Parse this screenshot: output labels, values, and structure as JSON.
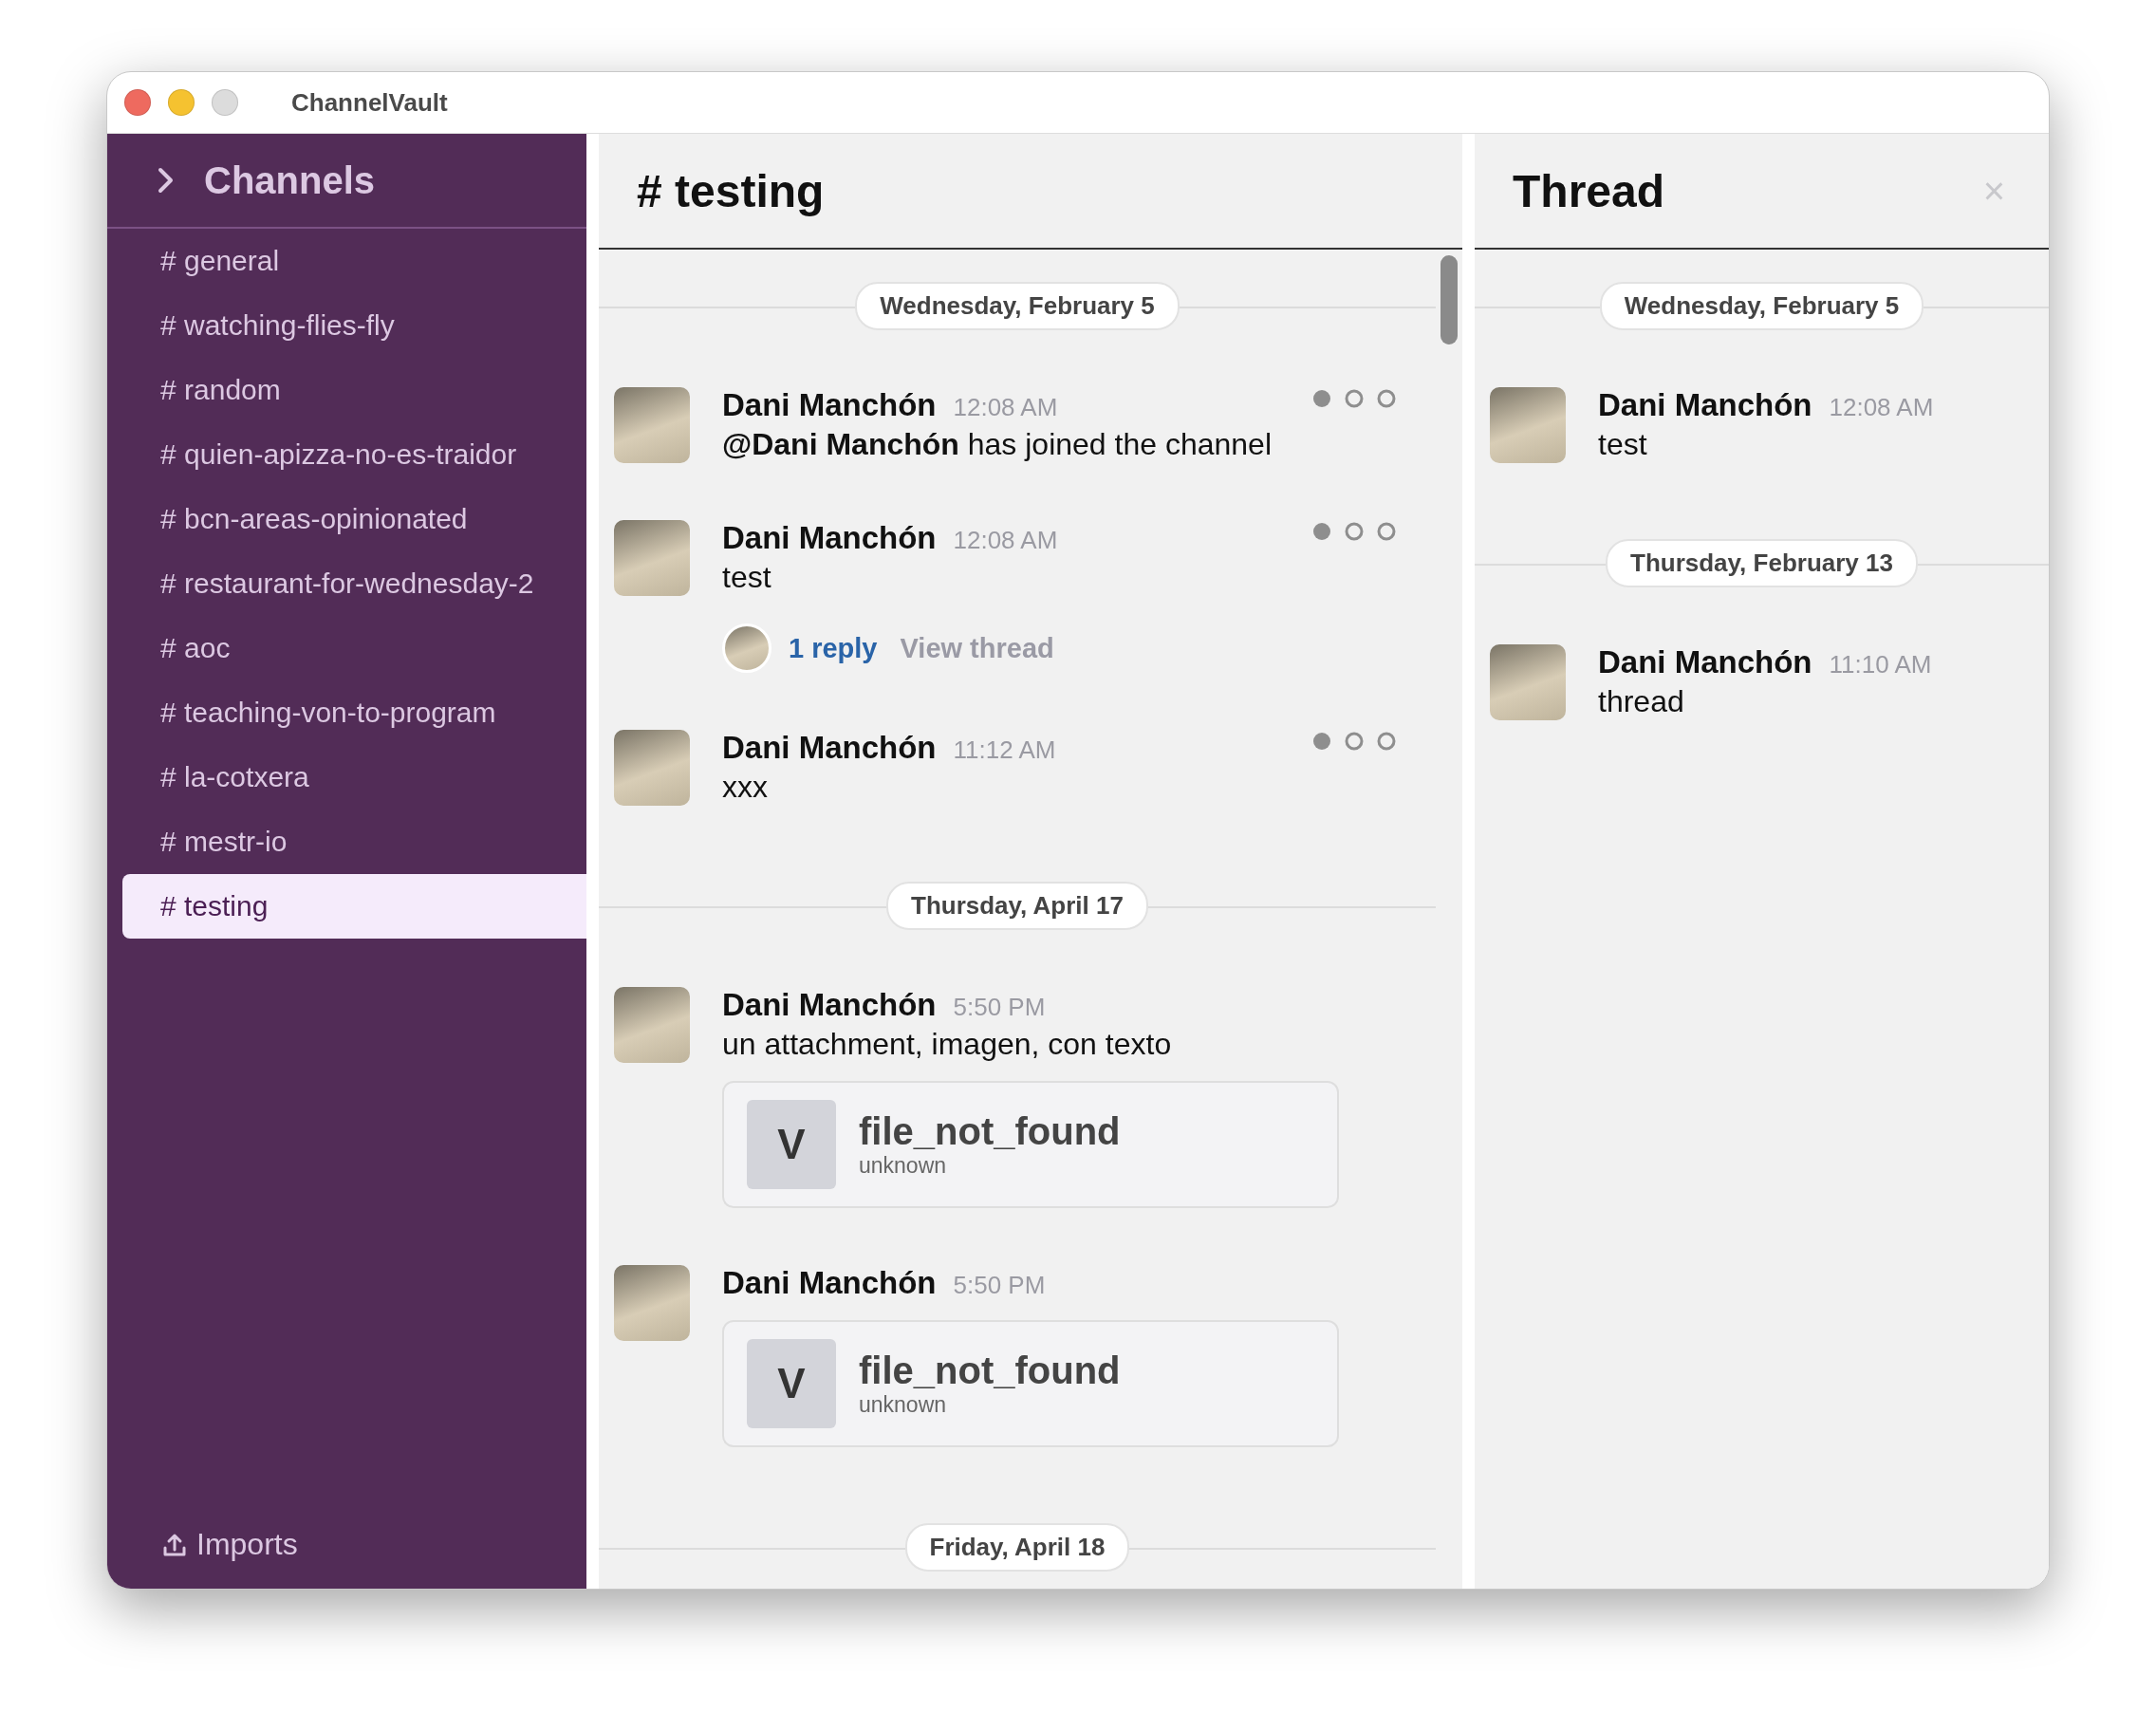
{
  "window": {
    "title": "ChannelVault"
  },
  "sidebar": {
    "header": "Channels",
    "channels": [
      {
        "name": "# general",
        "selected": false
      },
      {
        "name": "# watching-flies-fly",
        "selected": false
      },
      {
        "name": "# random",
        "selected": false
      },
      {
        "name": "# quien-apizza-no-es-traidor",
        "selected": false
      },
      {
        "name": "# bcn-areas-opinionated",
        "selected": false
      },
      {
        "name": "# restaurant-for-wednesday-2",
        "selected": false
      },
      {
        "name": "# aoc",
        "selected": false
      },
      {
        "name": "# teaching-von-to-program",
        "selected": false
      },
      {
        "name": "# la-cotxera",
        "selected": false
      },
      {
        "name": "# mestr-io",
        "selected": false
      },
      {
        "name": "# testing",
        "selected": true
      }
    ],
    "footer": "Imports"
  },
  "channel": {
    "title": "# testing",
    "timeline": [
      {
        "kind": "date",
        "label": "Wednesday, February 5"
      },
      {
        "kind": "message",
        "author": "Dani Manchón",
        "time": "12:08 AM",
        "text": "**@Dani Manchón** has joined the channel",
        "status_dots": true
      },
      {
        "kind": "message",
        "author": "Dani Manchón",
        "time": "12:08 AM",
        "text": "test",
        "replies": {
          "count": "1 reply",
          "link": "View thread"
        },
        "status_dots": true
      },
      {
        "kind": "message",
        "author": "Dani Manchón",
        "time": "11:12 AM",
        "text": "xxx",
        "status_dots": true
      },
      {
        "kind": "date",
        "label": "Thursday, April 17"
      },
      {
        "kind": "message",
        "author": "Dani Manchón",
        "time": "5:50 PM",
        "text": "un attachment, imagen, con texto",
        "attachments": [
          {
            "badge": "V",
            "name": "file_not_found",
            "type": "unknown"
          }
        ]
      },
      {
        "kind": "message",
        "author": "Dani Manchón",
        "time": "5:50 PM",
        "attachments": [
          {
            "badge": "V",
            "name": "file_not_found",
            "type": "unknown"
          }
        ]
      },
      {
        "kind": "date",
        "label": "Friday, April 18"
      }
    ]
  },
  "thread": {
    "title": "Thread",
    "close": "×",
    "timeline": [
      {
        "kind": "date",
        "label": "Wednesday, February 5"
      },
      {
        "kind": "message",
        "author": "Dani Manchón",
        "time": "12:08 AM",
        "text": "test"
      },
      {
        "kind": "date",
        "label": "Thursday, February 13"
      },
      {
        "kind": "message",
        "author": "Dani Manchón",
        "time": "11:10 AM",
        "text": "thread"
      }
    ]
  }
}
